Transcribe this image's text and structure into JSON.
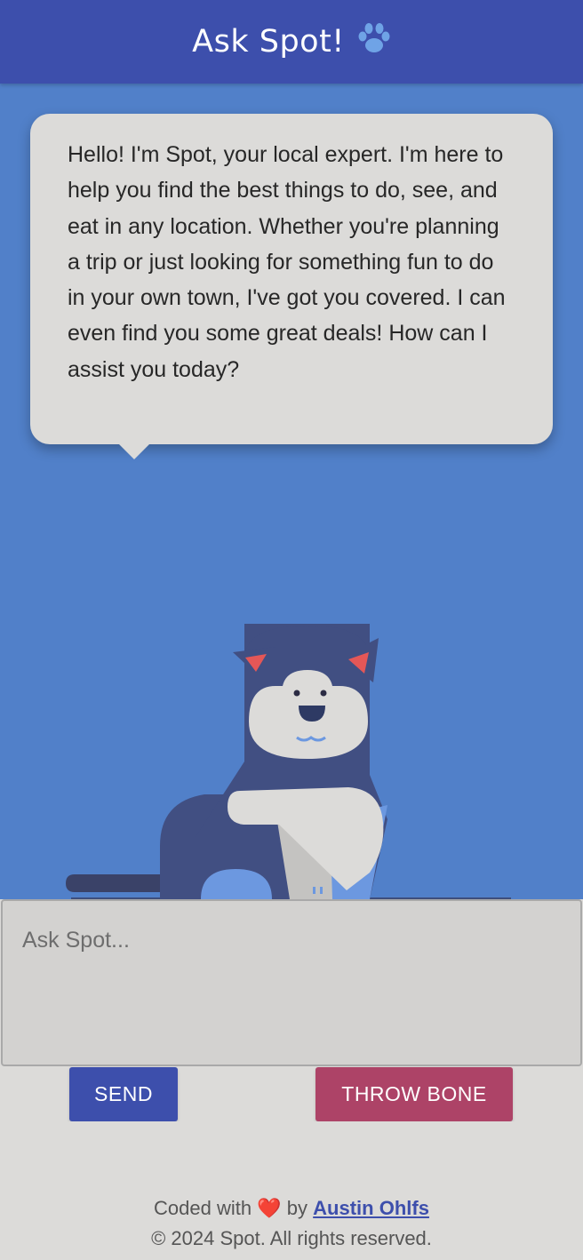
{
  "header": {
    "title": "Ask Spot!",
    "icon": "paw-icon"
  },
  "chat": {
    "message": "Hello! I'm Spot, your local expert. I'm here to help you find the best things to do, see, and eat in any location. Whether you're planning a trip or just looking for something fun to do in your own town, I've got you covered. I can even find you some great deals! How can I assist you today?"
  },
  "input": {
    "placeholder": "Ask Spot...",
    "value": ""
  },
  "buttons": {
    "send": "SEND",
    "throw_bone": "THROW BONE"
  },
  "footer": {
    "coded_with": "Coded with",
    "heart": "❤️",
    "by": "by",
    "author": "Austin Ohlfs",
    "copyright": "© 2024 Spot. All rights reserved."
  },
  "colors": {
    "header": "#3d4fac",
    "stage": "#5180c9",
    "send_button": "#3d4fac",
    "bone_button": "#ad4367"
  }
}
